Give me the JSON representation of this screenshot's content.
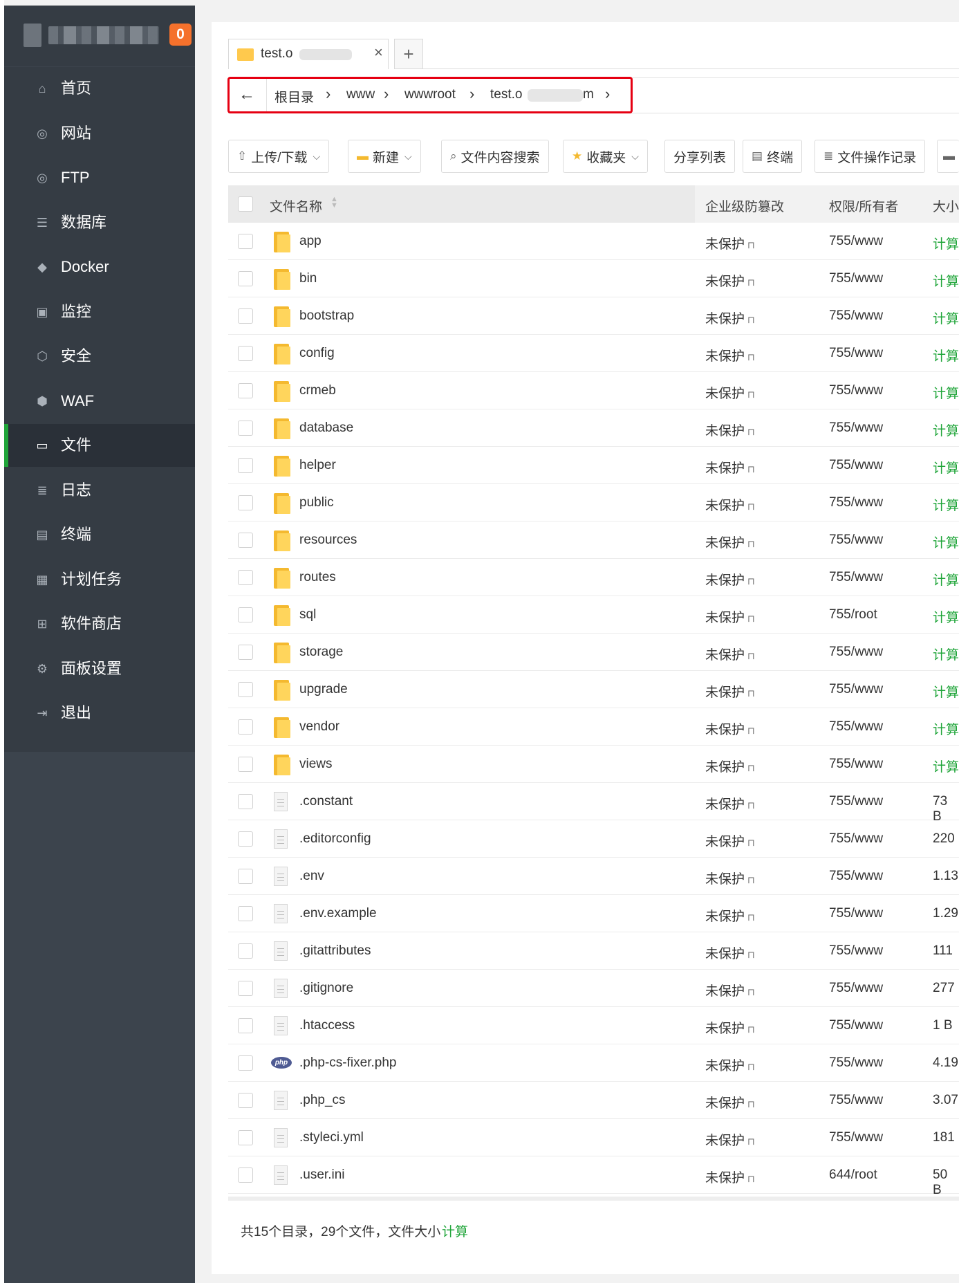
{
  "sidebar": {
    "notification_count": "0",
    "items": [
      {
        "label": "首页",
        "icon": "home-icon",
        "glyph": "⌂"
      },
      {
        "label": "网站",
        "icon": "globe-icon",
        "glyph": "◎"
      },
      {
        "label": "FTP",
        "icon": "ftp-globe-icon",
        "glyph": "◎"
      },
      {
        "label": "数据库",
        "icon": "database-icon",
        "glyph": "☰"
      },
      {
        "label": "Docker",
        "icon": "docker-icon",
        "glyph": "◆"
      },
      {
        "label": "监控",
        "icon": "monitor-icon",
        "glyph": "▣"
      },
      {
        "label": "安全",
        "icon": "shield-icon",
        "glyph": "⬡"
      },
      {
        "label": "WAF",
        "icon": "waf-shield-icon",
        "glyph": "⬢"
      },
      {
        "label": "文件",
        "icon": "folder-icon",
        "glyph": "▭"
      },
      {
        "label": "日志",
        "icon": "log-icon",
        "glyph": "≣"
      },
      {
        "label": "终端",
        "icon": "terminal-icon",
        "glyph": "▤"
      },
      {
        "label": "计划任务",
        "icon": "calendar-icon",
        "glyph": "▦"
      },
      {
        "label": "软件商店",
        "icon": "apps-grid-icon",
        "glyph": "⊞"
      },
      {
        "label": "面板设置",
        "icon": "gear-icon",
        "glyph": "⚙"
      },
      {
        "label": "退出",
        "icon": "logout-icon",
        "glyph": "⇥"
      }
    ],
    "active_index": 8
  },
  "tab": {
    "label": "test.o",
    "close": "×",
    "add": "+"
  },
  "breadcrumb": {
    "back": "←",
    "items": [
      "根目录",
      "www",
      "wwwroot",
      "test.o",
      "m"
    ],
    "separator": "›"
  },
  "toolbar": {
    "upload": "上传/下载",
    "new": "新建",
    "content_search": "文件内容搜索",
    "favorites": "收藏夹",
    "share_list": "分享列表",
    "terminal": "终端",
    "operation_log": "文件操作记录"
  },
  "table": {
    "headers": {
      "name": "文件名称",
      "protection": "企业级防篡改",
      "permission": "权限/所有者",
      "size": "大小"
    },
    "rows": [
      {
        "type": "folder",
        "name": "app",
        "protect": "未保护",
        "perm": "755/www",
        "size": "计算"
      },
      {
        "type": "folder",
        "name": "bin",
        "protect": "未保护",
        "perm": "755/www",
        "size": "计算"
      },
      {
        "type": "folder",
        "name": "bootstrap",
        "protect": "未保护",
        "perm": "755/www",
        "size": "计算"
      },
      {
        "type": "folder",
        "name": "config",
        "protect": "未保护",
        "perm": "755/www",
        "size": "计算"
      },
      {
        "type": "folder",
        "name": "crmeb",
        "protect": "未保护",
        "perm": "755/www",
        "size": "计算"
      },
      {
        "type": "folder",
        "name": "database",
        "protect": "未保护",
        "perm": "755/www",
        "size": "计算"
      },
      {
        "type": "folder",
        "name": "helper",
        "protect": "未保护",
        "perm": "755/www",
        "size": "计算"
      },
      {
        "type": "folder",
        "name": "public",
        "protect": "未保护",
        "perm": "755/www",
        "size": "计算"
      },
      {
        "type": "folder",
        "name": "resources",
        "protect": "未保护",
        "perm": "755/www",
        "size": "计算"
      },
      {
        "type": "folder",
        "name": "routes",
        "protect": "未保护",
        "perm": "755/www",
        "size": "计算"
      },
      {
        "type": "folder",
        "name": "sql",
        "protect": "未保护",
        "perm": "755/root",
        "size": "计算"
      },
      {
        "type": "folder",
        "name": "storage",
        "protect": "未保护",
        "perm": "755/www",
        "size": "计算"
      },
      {
        "type": "folder",
        "name": "upgrade",
        "protect": "未保护",
        "perm": "755/www",
        "size": "计算"
      },
      {
        "type": "folder",
        "name": "vendor",
        "protect": "未保护",
        "perm": "755/www",
        "size": "计算"
      },
      {
        "type": "folder",
        "name": "views",
        "protect": "未保护",
        "perm": "755/www",
        "size": "计算"
      },
      {
        "type": "file",
        "name": ".constant",
        "protect": "未保护",
        "perm": "755/www",
        "size": "73 B"
      },
      {
        "type": "file",
        "name": ".editorconfig",
        "protect": "未保护",
        "perm": "755/www",
        "size": "220"
      },
      {
        "type": "file",
        "name": ".env",
        "protect": "未保护",
        "perm": "755/www",
        "size": "1.13"
      },
      {
        "type": "file",
        "name": ".env.example",
        "protect": "未保护",
        "perm": "755/www",
        "size": "1.29"
      },
      {
        "type": "file",
        "name": ".gitattributes",
        "protect": "未保护",
        "perm": "755/www",
        "size": "111"
      },
      {
        "type": "file",
        "name": ".gitignore",
        "protect": "未保护",
        "perm": "755/www",
        "size": "277"
      },
      {
        "type": "file",
        "name": ".htaccess",
        "protect": "未保护",
        "perm": "755/www",
        "size": "1 B"
      },
      {
        "type": "php",
        "name": ".php-cs-fixer.php",
        "protect": "未保护",
        "perm": "755/www",
        "size": "4.19"
      },
      {
        "type": "file",
        "name": ".php_cs",
        "protect": "未保护",
        "perm": "755/www",
        "size": "3.07"
      },
      {
        "type": "file",
        "name": ".styleci.yml",
        "protect": "未保护",
        "perm": "755/www",
        "size": "181"
      },
      {
        "type": "file",
        "name": ".user.ini",
        "protect": "未保护",
        "perm": "644/root",
        "size": "50 B"
      }
    ]
  },
  "footer": {
    "summary": "共15个目录，29个文件，文件大小",
    "calc": "计算"
  },
  "colors": {
    "sidebar_bg": "#353c44",
    "accent_green": "#20a53a",
    "badge_orange": "#f5712c",
    "highlight_red": "#e60012"
  }
}
